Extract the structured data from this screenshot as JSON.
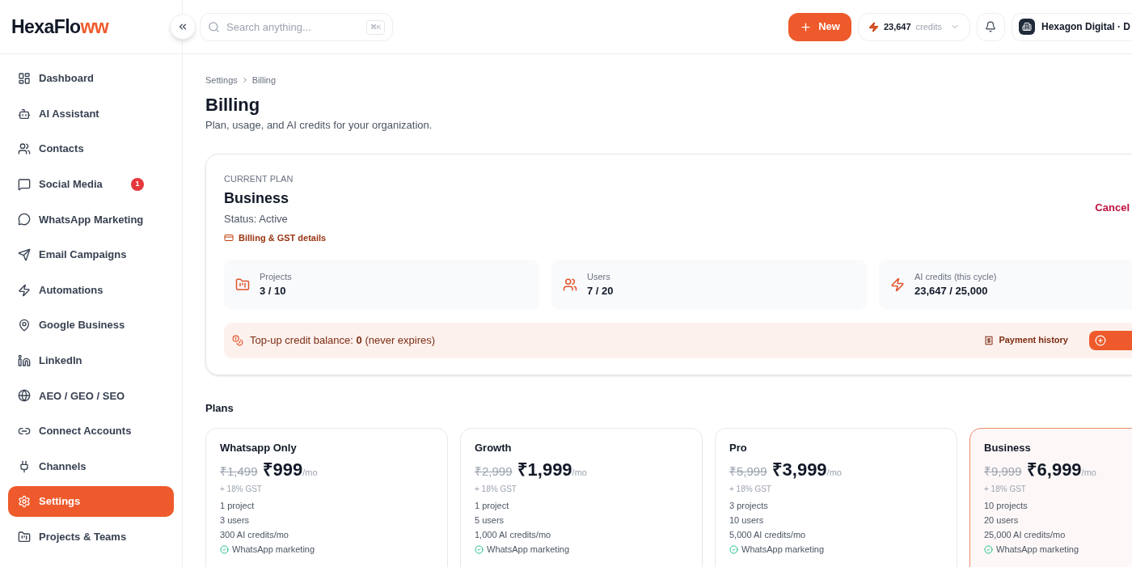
{
  "logo": {
    "text": "HexaFlo",
    "accent": "ww"
  },
  "header": {
    "search_placeholder": "Search anything...",
    "shortcut": "⌘K",
    "new_button": "New",
    "credits_value": "23,647",
    "credits_label": "credits",
    "workspace": "Hexagon Digital · D"
  },
  "sidebar": {
    "items": [
      {
        "label": "Dashboard",
        "selected": false
      },
      {
        "label": "AI Assistant",
        "selected": false
      },
      {
        "label": "Contacts",
        "selected": false
      },
      {
        "label": "Social Media",
        "selected": false,
        "badge": "1"
      },
      {
        "label": "WhatsApp Marketing",
        "selected": false
      },
      {
        "label": "Email Campaigns",
        "selected": false
      },
      {
        "label": "Automations",
        "selected": false
      },
      {
        "label": "Google Business",
        "selected": false
      },
      {
        "label": "LinkedIn",
        "selected": false
      },
      {
        "label": "AEO / GEO / SEO",
        "selected": false
      },
      {
        "label": "Connect Accounts",
        "selected": false
      },
      {
        "label": "Channels",
        "selected": false
      },
      {
        "label": "Settings",
        "selected": true
      },
      {
        "label": "Projects & Teams",
        "selected": false
      }
    ]
  },
  "breadcrumb": [
    "Settings",
    "Billing"
  ],
  "page": {
    "title": "Billing",
    "subtitle": "Plan, usage, and AI credits for your organization."
  },
  "current_plan": {
    "eyebrow": "CURRENT PLAN",
    "name": "Business",
    "status": "Status: Active",
    "details_link": "Billing & GST details",
    "cancel": "Cancel",
    "stats": [
      {
        "label": "Projects",
        "value": "3 / 10"
      },
      {
        "label": "Users",
        "value": "7 / 20"
      },
      {
        "label": "AI credits (this cycle)",
        "value": "23,647 / 25,000"
      }
    ],
    "topup": "Top-up credit balance: **0** (never expires)",
    "payment_history": "Payment history"
  },
  "plans_title": "Plans",
  "plans": [
    {
      "name": "Whatsapp Only",
      "old_price": "₹1,499",
      "price": "₹999",
      "period": "/mo",
      "tax": "+ 18% GST",
      "features": [
        "1 project",
        "3 users",
        "300 AI credits/mo"
      ],
      "checks": [
        "WhatsApp marketing"
      ],
      "selected": false
    },
    {
      "name": "Growth",
      "old_price": "₹2,999",
      "price": "₹1,999",
      "period": "/mo",
      "tax": "+ 18% GST",
      "features": [
        "1 project",
        "5 users",
        "1,000 AI credits/mo"
      ],
      "checks": [
        "WhatsApp marketing"
      ],
      "selected": false
    },
    {
      "name": "Pro",
      "old_price": "₹5,999",
      "price": "₹3,999",
      "period": "/mo",
      "tax": "+ 18% GST",
      "features": [
        "3 projects",
        "10 users",
        "5,000 AI credits/mo"
      ],
      "checks": [
        "WhatsApp marketing"
      ],
      "selected": false
    },
    {
      "name": "Business",
      "old_price": "₹9,999",
      "price": "₹6,999",
      "period": "/mo",
      "tax": "+ 18% GST",
      "features": [
        "10 projects",
        "20 users",
        "25,000 AI credits/mo"
      ],
      "checks": [
        "WhatsApp marketing"
      ],
      "selected": true
    }
  ]
}
